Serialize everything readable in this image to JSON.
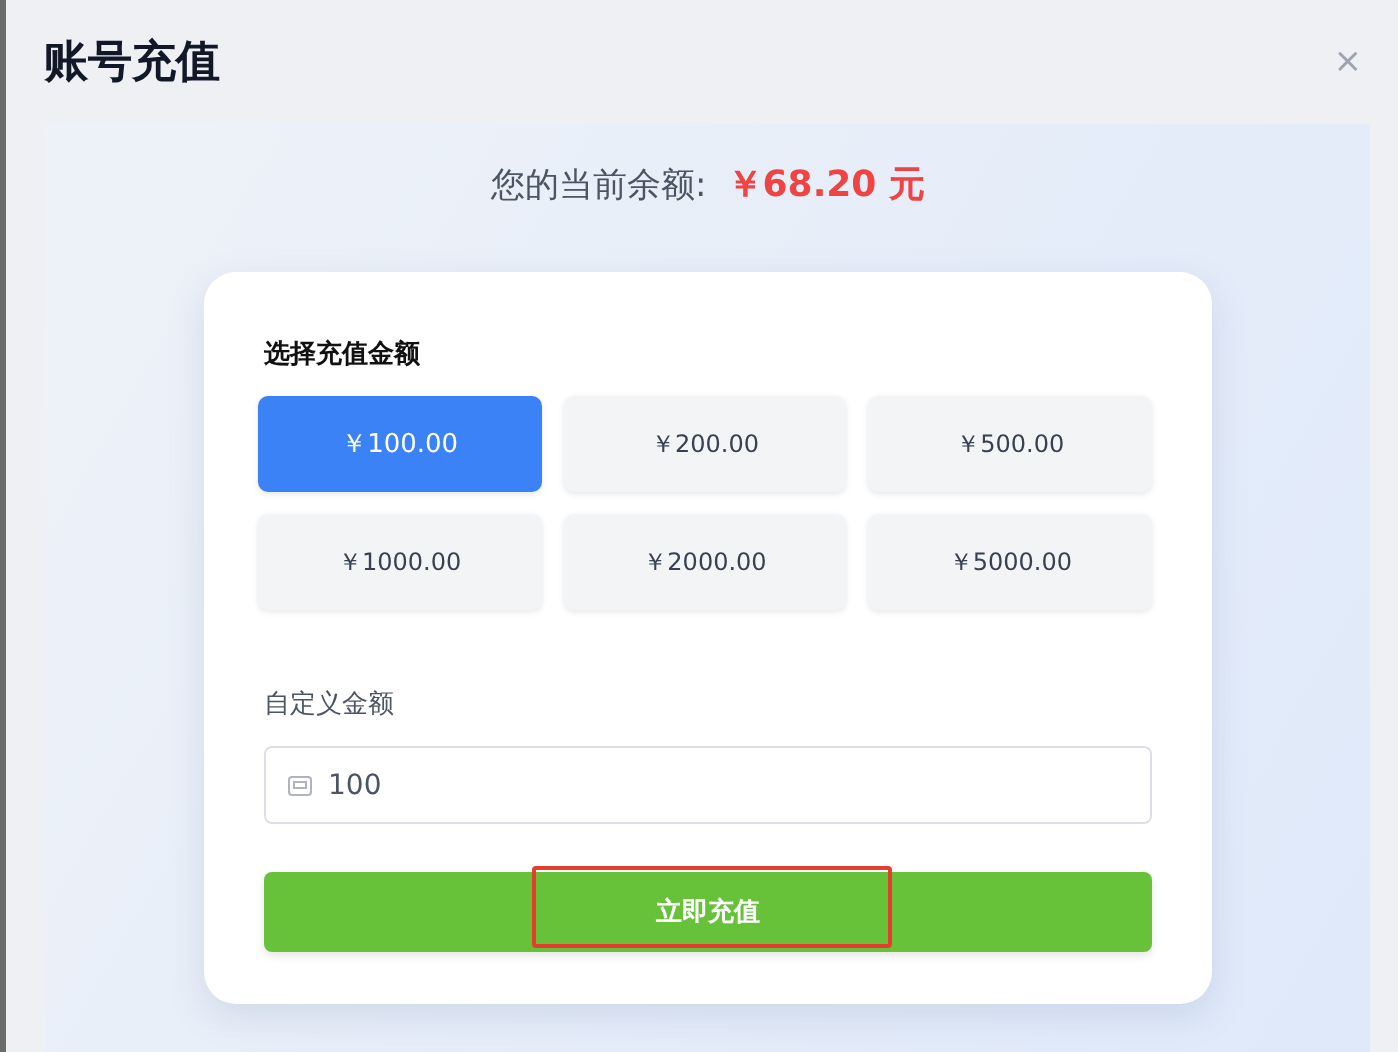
{
  "dialog": {
    "title": "账号充值",
    "close": "×"
  },
  "balance": {
    "label": "您的当前余额:",
    "amount": "￥68.20 元"
  },
  "preset_label": "选择充值金额",
  "amounts": [
    {
      "label": "￥100.00",
      "selected": true
    },
    {
      "label": "￥200.00",
      "selected": false
    },
    {
      "label": "￥500.00",
      "selected": false
    },
    {
      "label": "￥1000.00",
      "selected": false
    },
    {
      "label": "￥2000.00",
      "selected": false
    },
    {
      "label": "￥5000.00",
      "selected": false
    }
  ],
  "custom": {
    "label": "自定义金额",
    "value": "100"
  },
  "submit": {
    "label": "立即充值",
    "highlighted": true
  }
}
